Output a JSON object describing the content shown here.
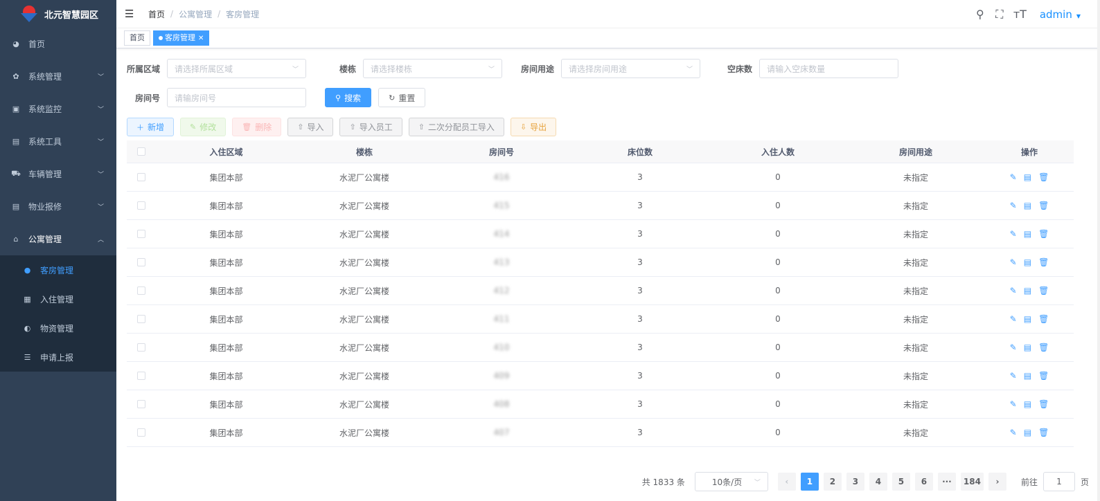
{
  "brand": {
    "name": "北元智慧园区"
  },
  "sidebar": {
    "items": [
      {
        "label": "首页",
        "icon": "dashboard-icon",
        "glyph": "◕"
      },
      {
        "label": "系统管理",
        "icon": "gear-icon",
        "glyph": "✿"
      },
      {
        "label": "系统监控",
        "icon": "monitor-icon",
        "glyph": "▣"
      },
      {
        "label": "系统工具",
        "icon": "toolbox-icon",
        "glyph": "▤"
      },
      {
        "label": "车辆管理",
        "icon": "cart-icon",
        "glyph": "⛟"
      },
      {
        "label": "物业报修",
        "icon": "toolbox-icon",
        "glyph": "▤"
      },
      {
        "label": "公寓管理",
        "icon": "apartment-icon",
        "glyph": "⌂"
      }
    ],
    "sub_items": [
      {
        "label": "客房管理",
        "icon": "user-icon",
        "glyph": "●"
      },
      {
        "label": "入住管理",
        "icon": "checkin-icon",
        "glyph": "▦"
      },
      {
        "label": "物资管理",
        "icon": "supplies-icon",
        "glyph": "◐"
      },
      {
        "label": "申请上报",
        "icon": "list-icon",
        "glyph": "☰"
      }
    ]
  },
  "header": {
    "breadcrumb": [
      "首页",
      "公寓管理",
      "客房管理"
    ],
    "user": "admin"
  },
  "tags": {
    "home": "首页",
    "current": "客房管理"
  },
  "filters": {
    "area_label": "所属区域",
    "area_placeholder": "请选择所属区域",
    "building_label": "楼栋",
    "building_placeholder": "请选择楼栋",
    "usage_label": "房间用途",
    "usage_placeholder": "请选择房间用途",
    "empty_label": "空床数",
    "empty_placeholder": "请输入空床数量",
    "room_label": "房间号",
    "room_placeholder": "请输房间号",
    "search": "搜索",
    "reset": "重置"
  },
  "toolbar": {
    "add": "新增",
    "edit": "修改",
    "delete": "删除",
    "import": "导入",
    "import_staff": "导入员工",
    "import_reassign": "二次分配员工导入",
    "export": "导出"
  },
  "table": {
    "headers": [
      "入住区域",
      "楼栋",
      "房间号",
      "床位数",
      "入住人数",
      "房间用途",
      "操作"
    ],
    "rows": [
      [
        "集团本部",
        "水泥厂公寓楼",
        "416",
        "3",
        "0",
        "未指定"
      ],
      [
        "集团本部",
        "水泥厂公寓楼",
        "415",
        "3",
        "0",
        "未指定"
      ],
      [
        "集团本部",
        "水泥厂公寓楼",
        "414",
        "3",
        "0",
        "未指定"
      ],
      [
        "集团本部",
        "水泥厂公寓楼",
        "413",
        "3",
        "0",
        "未指定"
      ],
      [
        "集团本部",
        "水泥厂公寓楼",
        "412",
        "3",
        "0",
        "未指定"
      ],
      [
        "集团本部",
        "水泥厂公寓楼",
        "411",
        "3",
        "0",
        "未指定"
      ],
      [
        "集团本部",
        "水泥厂公寓楼",
        "410",
        "3",
        "0",
        "未指定"
      ],
      [
        "集团本部",
        "水泥厂公寓楼",
        "409",
        "3",
        "0",
        "未指定"
      ],
      [
        "集团本部",
        "水泥厂公寓楼",
        "408",
        "3",
        "0",
        "未指定"
      ],
      [
        "集团本部",
        "水泥厂公寓楼",
        "407",
        "3",
        "0",
        "未指定"
      ]
    ]
  },
  "pagination": {
    "total": "共 1833 条",
    "page_size": "10条/页",
    "pages": [
      "1",
      "2",
      "3",
      "4",
      "5",
      "6",
      "···",
      "184"
    ],
    "current": "1",
    "goto_prefix": "前往",
    "goto_value": "1",
    "goto_suffix": "页"
  },
  "colors": {
    "sidebar_bg": "#304156",
    "submenu_bg": "#1f2d3d",
    "accent": "#409eff"
  }
}
